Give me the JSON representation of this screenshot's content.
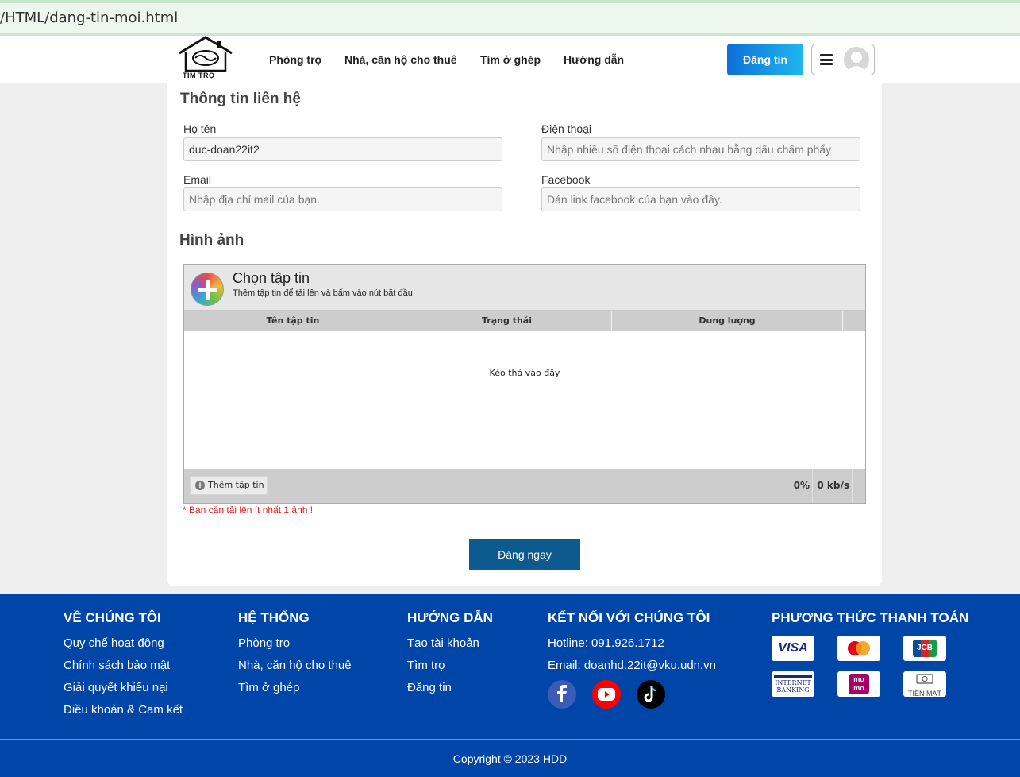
{
  "browser": {
    "url": "/HTML/dang-tin-moi.html"
  },
  "header": {
    "logo_text": "TÌM TRỌ",
    "nav": [
      "Phòng trọ",
      "Nhà, căn hộ cho thuê",
      "Tìm ở ghép",
      "Hướng dẫn"
    ],
    "post_button": "Đăng tin"
  },
  "contact": {
    "title": "Thông tin liên hệ",
    "name_label": "Họ tên",
    "name_value": "duc-doan22it2",
    "phone_label": "Điện thoại",
    "phone_placeholder": "Nhập nhiều số điện thoại cách nhau bằng dấu chấm phẩy",
    "email_label": "Email",
    "email_placeholder": "Nhập địa chỉ mail của bạn.",
    "facebook_label": "Facebook",
    "facebook_placeholder": "Dán link facebook của bạn vào đây."
  },
  "images": {
    "title": "Hình ảnh",
    "choose_title": "Chọn tập tin",
    "choose_sub": "Thêm tập tin để tải lên và bấm vào nút bắt đầu",
    "columns": [
      "Tên tập tin",
      "Trạng thái",
      "Dung lượng"
    ],
    "drop_text": "Kéo thả vào đây",
    "add_file": "Thêm tập tin",
    "percent": "0%",
    "speed": "0 kb/s",
    "warning": "* Bạn cần tải lên ít nhất 1 ảnh !"
  },
  "submit_label": "Đăng ngay",
  "footer": {
    "about": {
      "title": "VỀ CHÚNG TÔI",
      "items": [
        "Quy chế hoạt động",
        "Chính sách bảo mật",
        "Giải quyết khiếu nại",
        "Điều khoản & Cam kết"
      ]
    },
    "system": {
      "title": "HỆ THỐNG",
      "items": [
        "Phòng trọ",
        "Nhà, căn hộ cho thuê",
        "Tìm ở ghép"
      ]
    },
    "guide": {
      "title": "HƯỚNG DẪN",
      "items": [
        "Tạo tài khoản",
        "Tìm trọ",
        "Đăng tin"
      ]
    },
    "connect": {
      "title": "KẾT NỐI VỚI CHÚNG TÔI",
      "hotline": "Hotline: 091.926.1712",
      "email": "Email: doanhd.22it@vku.udn.vn"
    },
    "payment": {
      "title": "PHƯƠNG THỨC THANH TOÁN",
      "labels": [
        "VISA",
        "JCB",
        "INTERNET",
        "BANKING",
        "mo",
        "mo",
        "TIỀN MẶT"
      ]
    },
    "copyright": "Copyright © 2023 HDD"
  },
  "colors": {
    "footer_bg": "#0046a9",
    "submit_bg": "#0c5a8e",
    "warning": "#e02020"
  }
}
